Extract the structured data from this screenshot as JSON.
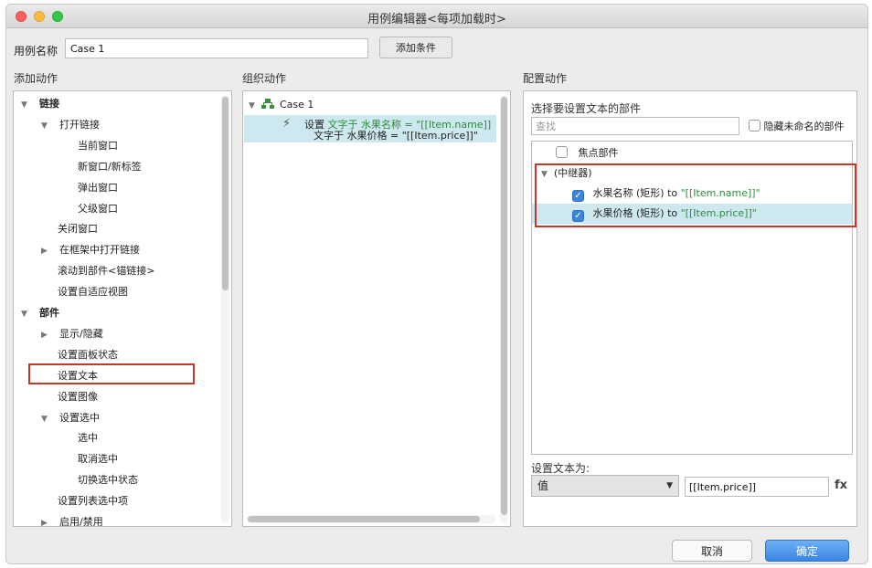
{
  "window": {
    "title": "用例编辑器<每项加载时>"
  },
  "case_name": {
    "label": "用例名称",
    "value": "Case 1"
  },
  "add_condition_label": "添加条件",
  "sections": {
    "add_actions": "添加动作",
    "organize_actions": "组织动作",
    "configure_actions": "配置动作"
  },
  "actions_tree": [
    {
      "label": "链接",
      "level": 0,
      "expand": "down",
      "bold": true
    },
    {
      "label": "打开链接",
      "level": 1,
      "expand": "down"
    },
    {
      "label": "当前窗口",
      "level": 2
    },
    {
      "label": "新窗口/新标签",
      "level": 2
    },
    {
      "label": "弹出窗口",
      "level": 2
    },
    {
      "label": "父级窗口",
      "level": 2
    },
    {
      "label": "关闭窗口",
      "level": 1
    },
    {
      "label": "在框架中打开链接",
      "level": 1,
      "expand": "right"
    },
    {
      "label": "滚动到部件<锚链接>",
      "level": 1
    },
    {
      "label": "设置自适应视图",
      "level": 1
    },
    {
      "label": "部件",
      "level": 0,
      "expand": "down",
      "bold": true
    },
    {
      "label": "显示/隐藏",
      "level": 1,
      "expand": "right"
    },
    {
      "label": "设置面板状态",
      "level": 1
    },
    {
      "label": "设置文本",
      "level": 1
    },
    {
      "label": "设置图像",
      "level": 1
    },
    {
      "label": "设置选中",
      "level": 1,
      "expand": "down"
    },
    {
      "label": "选中",
      "level": 2
    },
    {
      "label": "取消选中",
      "level": 2
    },
    {
      "label": "切换选中状态",
      "level": 2
    },
    {
      "label": "设置列表选中项",
      "level": 1
    },
    {
      "label": "启用/禁用",
      "level": 1,
      "expand": "right"
    }
  ],
  "organize": {
    "case_label": "Case 1",
    "action": {
      "verb": "设置",
      "line1_target": "文字于 水果名称 = \"[[Item.name]]",
      "line2_target": "文字于 水果价格 = \"[[Item.price]]\""
    }
  },
  "configure": {
    "select_label": "选择要设置文本的部件",
    "search_placeholder": "查找",
    "hide_unnamed_label": "隐藏未命名的部件",
    "widgets": {
      "focus_label": "焦点部件",
      "repeater_label": "(中继器)",
      "item1_name": "水果名称 (矩形) to ",
      "item1_value": "\"[[Item.name]]\"",
      "item2_name": "水果价格 (矩形) to ",
      "item2_value": "\"[[Item.price]]\""
    },
    "set_text_label": "设置文本为:",
    "value_type": "值",
    "value_input": "[[Item.price]]",
    "fx_label": "fx"
  },
  "buttons": {
    "cancel": "取消",
    "ok": "确定"
  },
  "colors": {
    "accent": "#3b86e3",
    "highlight_border": "#c0392b",
    "selection": "#cde8ee",
    "value_green": "#2e8b3d"
  }
}
